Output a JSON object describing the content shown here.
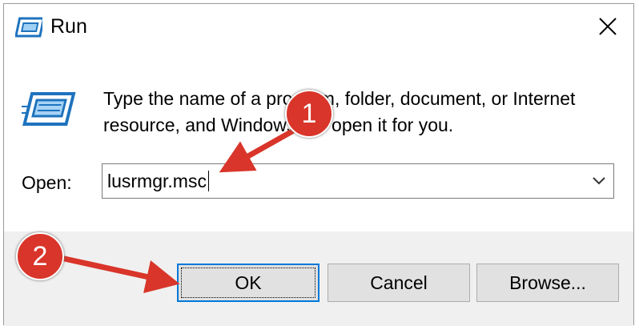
{
  "window": {
    "title": "Run"
  },
  "dialog": {
    "description": "Type the name of a program, folder, document, or Internet resource, and Windows will open it for you.",
    "open_label": "Open:",
    "open_value": "lusrmgr.msc"
  },
  "buttons": {
    "ok": "OK",
    "cancel": "Cancel",
    "browse": "Browse..."
  },
  "annotations": {
    "step1": "1",
    "step2": "2"
  },
  "colors": {
    "callout": "#d9352a",
    "focus_border": "#0078d7",
    "footer_bg": "#f0f0f0"
  },
  "icons": {
    "title": "run-dialog-icon",
    "body": "run-dialog-icon",
    "close": "close-icon",
    "dropdown": "chevron-down-icon"
  }
}
